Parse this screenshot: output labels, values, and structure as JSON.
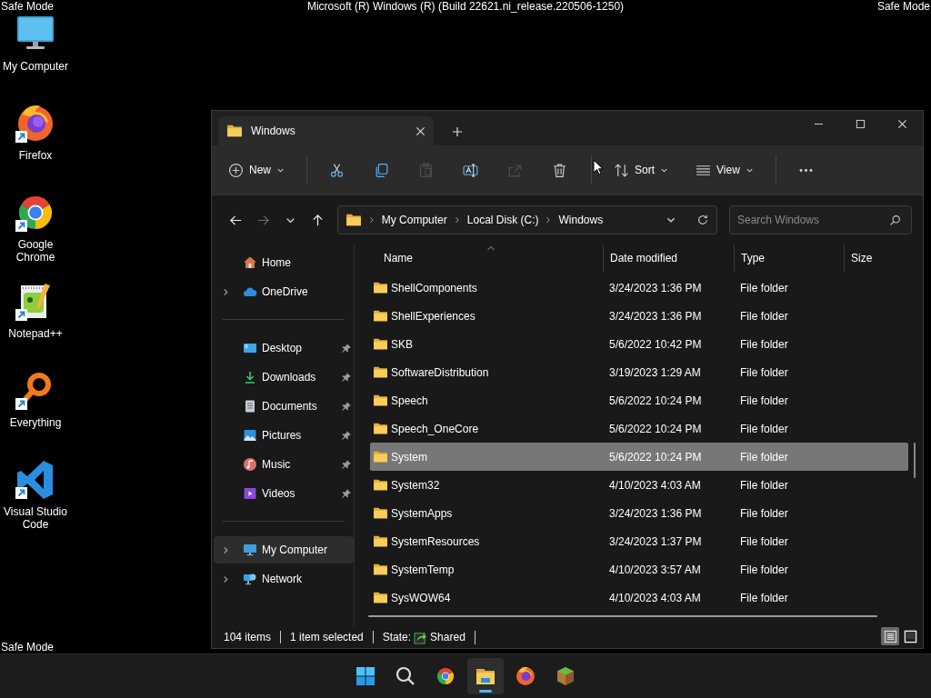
{
  "desktop": {
    "header": "Microsoft (R) Windows (R) (Build 22621.ni_release.220506-1250)",
    "corner_labels": [
      "Safe Mode",
      "Safe Mode",
      "Safe Mode"
    ],
    "icons": [
      {
        "label": "My Computer",
        "kind": "computer",
        "shortcut": false
      },
      {
        "label": "Firefox",
        "kind": "firefox",
        "shortcut": true
      },
      {
        "label": "Google Chrome",
        "kind": "chrome",
        "shortcut": true
      },
      {
        "label": "Notepad++",
        "kind": "notepad",
        "shortcut": true
      },
      {
        "label": "Everything",
        "kind": "everything",
        "shortcut": true
      },
      {
        "label": "Visual Studio Code",
        "kind": "vscode",
        "shortcut": true
      }
    ]
  },
  "window": {
    "tabs": [
      {
        "label": "Windows",
        "selected": true
      }
    ],
    "toolbar": [
      {
        "kind": "new",
        "label": "New",
        "dropdown": true,
        "disabled": false
      },
      {
        "kind": "separator"
      },
      {
        "kind": "cut",
        "disabled": false
      },
      {
        "kind": "copy",
        "disabled": false
      },
      {
        "kind": "paste",
        "disabled": true
      },
      {
        "kind": "rename",
        "disabled": false
      },
      {
        "kind": "share",
        "disabled": true
      },
      {
        "kind": "delete",
        "disabled": false
      },
      {
        "kind": "separator"
      },
      {
        "kind": "sort",
        "label": "Sort",
        "dropdown": true,
        "disabled": false
      },
      {
        "kind": "view",
        "label": "View",
        "dropdown": true,
        "disabled": false
      },
      {
        "kind": "separator"
      },
      {
        "kind": "more",
        "disabled": false
      }
    ],
    "nav_buttons": [
      {
        "kind": "back",
        "disabled": false
      },
      {
        "kind": "forward",
        "disabled": true
      },
      {
        "kind": "recent",
        "disabled": false
      },
      {
        "kind": "up",
        "disabled": false
      }
    ],
    "breadcrumbs": [
      "My Computer",
      "Local Disk (C:)",
      "Windows"
    ],
    "search": {
      "placeholder": "Search Windows"
    },
    "sidebar": {
      "groups": [
        [
          {
            "label": "Home",
            "kind": "home",
            "expandable": false,
            "pinned": false,
            "selected": false
          },
          {
            "label": "OneDrive",
            "kind": "cloud",
            "expandable": true,
            "pinned": false,
            "selected": false
          }
        ],
        [
          {
            "label": "Desktop",
            "kind": "desktop",
            "expandable": false,
            "pinned": true,
            "selected": false
          },
          {
            "label": "Downloads",
            "kind": "download",
            "expandable": false,
            "pinned": true,
            "selected": false
          },
          {
            "label": "Documents",
            "kind": "documents",
            "expandable": false,
            "pinned": true,
            "selected": false
          },
          {
            "label": "Pictures",
            "kind": "pictures",
            "expandable": false,
            "pinned": true,
            "selected": false
          },
          {
            "label": "Music",
            "kind": "music",
            "expandable": false,
            "pinned": true,
            "selected": false
          },
          {
            "label": "Videos",
            "kind": "videos",
            "expandable": false,
            "pinned": true,
            "selected": false
          }
        ],
        [
          {
            "label": "My Computer",
            "kind": "computer",
            "expandable": true,
            "pinned": false,
            "selected": true
          },
          {
            "label": "Network",
            "kind": "network",
            "expandable": true,
            "pinned": false,
            "selected": false
          }
        ]
      ]
    },
    "table": {
      "columns": [
        {
          "label": "Name",
          "sorted": true
        },
        {
          "label": "Date modified",
          "sorted": false
        },
        {
          "label": "Type",
          "sorted": false
        },
        {
          "label": "Size",
          "sorted": false
        }
      ],
      "rows": [
        {
          "name": "ShellComponents",
          "date": "3/24/2023 1:36 PM",
          "type": "File folder",
          "selected": false
        },
        {
          "name": "ShellExperiences",
          "date": "3/24/2023 1:36 PM",
          "type": "File folder",
          "selected": false
        },
        {
          "name": "SKB",
          "date": "5/6/2022 10:42 PM",
          "type": "File folder",
          "selected": false
        },
        {
          "name": "SoftwareDistribution",
          "date": "3/19/2023 1:29 AM",
          "type": "File folder",
          "selected": false
        },
        {
          "name": "Speech",
          "date": "5/6/2022 10:24 PM",
          "type": "File folder",
          "selected": false
        },
        {
          "name": "Speech_OneCore",
          "date": "5/6/2022 10:24 PM",
          "type": "File folder",
          "selected": false
        },
        {
          "name": "System",
          "date": "5/6/2022 10:24 PM",
          "type": "File folder",
          "selected": true
        },
        {
          "name": "System32",
          "date": "4/10/2023 4:03 AM",
          "type": "File folder",
          "selected": false
        },
        {
          "name": "SystemApps",
          "date": "3/24/2023 1:36 PM",
          "type": "File folder",
          "selected": false
        },
        {
          "name": "SystemResources",
          "date": "3/24/2023 1:37 PM",
          "type": "File folder",
          "selected": false
        },
        {
          "name": "SystemTemp",
          "date": "4/10/2023 3:57 AM",
          "type": "File folder",
          "selected": false
        },
        {
          "name": "SysWOW64",
          "date": "4/10/2023 4:03 AM",
          "type": "File folder",
          "selected": false
        }
      ]
    },
    "status_bar": {
      "counts": [
        "104 items",
        "1 item selected"
      ],
      "state_label": "State:",
      "state_value": "Shared"
    },
    "views": [
      {
        "kind": "details",
        "selected": true
      },
      {
        "kind": "tiles",
        "selected": false
      }
    ]
  },
  "taskbar": [
    {
      "kind": "start",
      "active": false
    },
    {
      "kind": "search",
      "active": false
    },
    {
      "kind": "chrome",
      "active": false
    },
    {
      "kind": "explorer",
      "active": true
    },
    {
      "kind": "firefox",
      "active": false
    },
    {
      "kind": "block",
      "active": false
    }
  ]
}
